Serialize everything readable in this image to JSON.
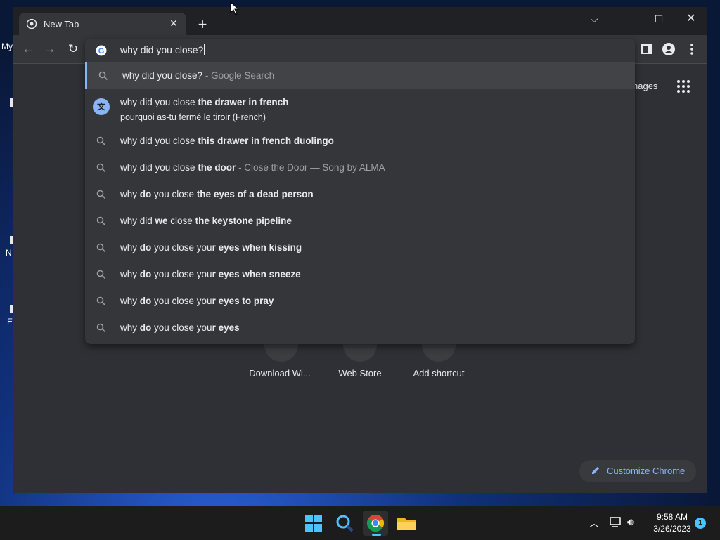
{
  "desktop": {
    "fragments": [
      "My",
      "N",
      "E"
    ]
  },
  "browser": {
    "tab": {
      "title": "New Tab",
      "close_icon": "close-icon"
    },
    "omnibox": {
      "input_value": "why did you close?",
      "suggestions": [
        {
          "type": "search",
          "prefix": "why did you close?",
          "suffix": " - Google Search"
        },
        {
          "type": "translate",
          "plain": "why did you close ",
          "bold": "the drawer in french",
          "line2": "pourquoi as-tu fermé le tiroir (French)"
        },
        {
          "type": "search",
          "plain": "why did you close ",
          "bold": "this drawer in french duolingo"
        },
        {
          "type": "search",
          "plain": "why did you close ",
          "bold": "the door",
          "dim": " - Close the Door — Song by ALMA"
        },
        {
          "type": "search",
          "p1": "why ",
          "b1": "do",
          "p2": " you close ",
          "b2": "the eyes of a dead person"
        },
        {
          "type": "search",
          "p1": "why did ",
          "b1": "we",
          "p2": " close ",
          "b2": "the keystone pipeline"
        },
        {
          "type": "search",
          "p1": "why ",
          "b1": "do",
          "p2": " you close you",
          "b2": "r eyes when kissing"
        },
        {
          "type": "search",
          "p1": "why ",
          "b1": "do",
          "p2": " you close you",
          "b2": "r eyes when sneeze"
        },
        {
          "type": "search",
          "p1": "why ",
          "b1": "do",
          "p2": " you close you",
          "b2": "r eyes to pray"
        },
        {
          "type": "search",
          "p1": "why ",
          "b1": "do",
          "p2": " you close you",
          "b2": "r eyes"
        }
      ]
    },
    "ntp": {
      "images_link": "nages",
      "shortcuts": [
        "Download Wi...",
        "Web Store",
        "Add shortcut"
      ],
      "customize_label": "Customize Chrome"
    }
  },
  "taskbar": {
    "time": "9:58 AM",
    "date": "3/26/2023",
    "notification_count": "1"
  },
  "colors": {
    "accent": "#8ab4f8",
    "taskbar_accent": "#4cc2ff"
  }
}
